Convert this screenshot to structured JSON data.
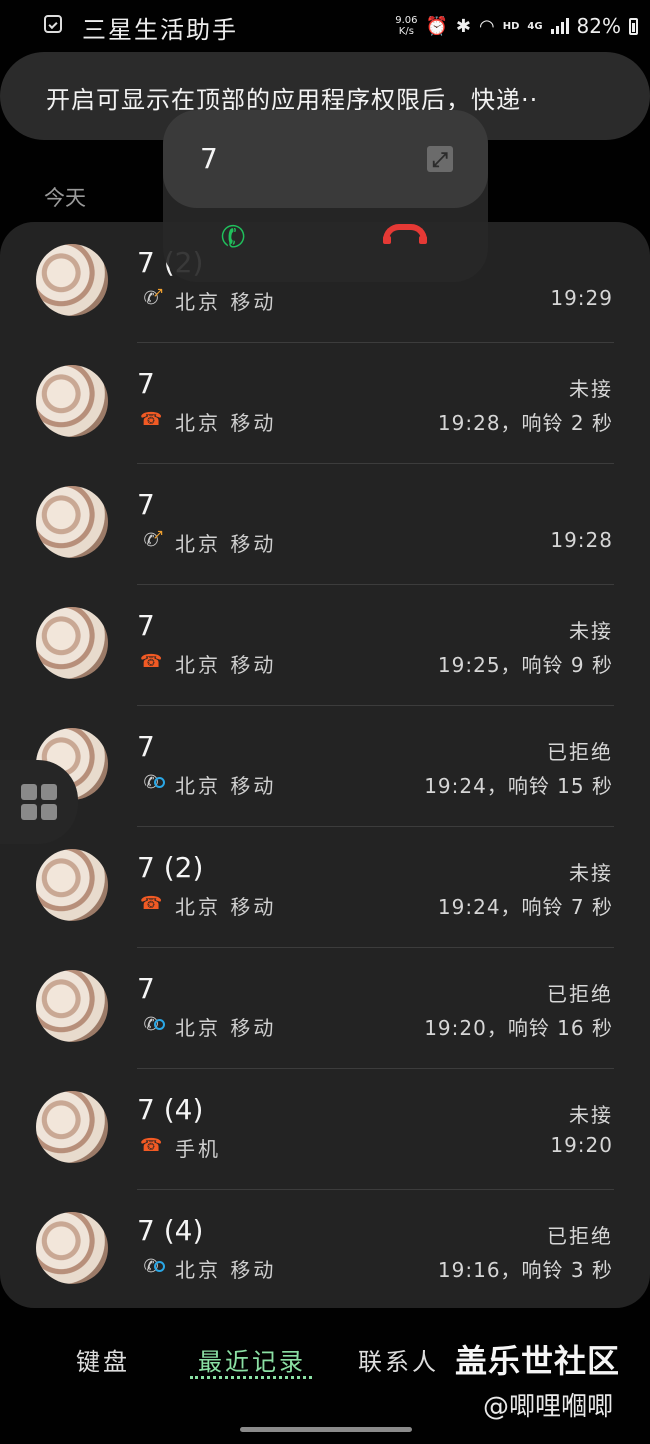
{
  "status_bar": {
    "app_title": "三星生活助手",
    "net_speed_value": "9.06",
    "net_speed_unit": "K/s",
    "hd_label": "HD",
    "net_type": "4G",
    "battery": "82%"
  },
  "notice": {
    "text": "开启可显示在顶部的应用程序权限后，快递··"
  },
  "floating_call": {
    "number": "7"
  },
  "section": {
    "today": "今天"
  },
  "calls": [
    {
      "name": "7 (2)",
      "location": "北京 移动",
      "status": "",
      "time": "19:29",
      "type": "outgoing"
    },
    {
      "name": "7",
      "location": "北京 移动",
      "status": "未接",
      "time": "19:28，响铃 2 秒",
      "type": "missed"
    },
    {
      "name": "7",
      "location": "北京 移动",
      "status": "",
      "time": "19:28",
      "type": "outgoing"
    },
    {
      "name": "7",
      "location": "北京 移动",
      "status": "未接",
      "time": "19:25，响铃 9 秒",
      "type": "missed"
    },
    {
      "name": "7",
      "location": "北京 移动",
      "status": "已拒绝",
      "time": "19:24，响铃 15 秒",
      "type": "rejected"
    },
    {
      "name": "7 (2)",
      "location": "北京 移动",
      "status": "未接",
      "time": "19:24，响铃 7 秒",
      "type": "missed"
    },
    {
      "name": "7",
      "location": "北京 移动",
      "status": "已拒绝",
      "time": "19:20，响铃 16 秒",
      "type": "rejected"
    },
    {
      "name": "7 (4)",
      "location": "手机",
      "status": "未接",
      "time": "19:20",
      "type": "missed"
    },
    {
      "name": "7 (4)",
      "location": "北京 移动",
      "status": "已拒绝",
      "time": "19:16，响铃 3 秒",
      "type": "rejected"
    }
  ],
  "tabs": {
    "keypad": "键盘",
    "recents": "最近记录",
    "contacts": "联系人"
  },
  "watermark": {
    "title": "盖乐世社区",
    "user": "@唧哩嗰唧"
  }
}
